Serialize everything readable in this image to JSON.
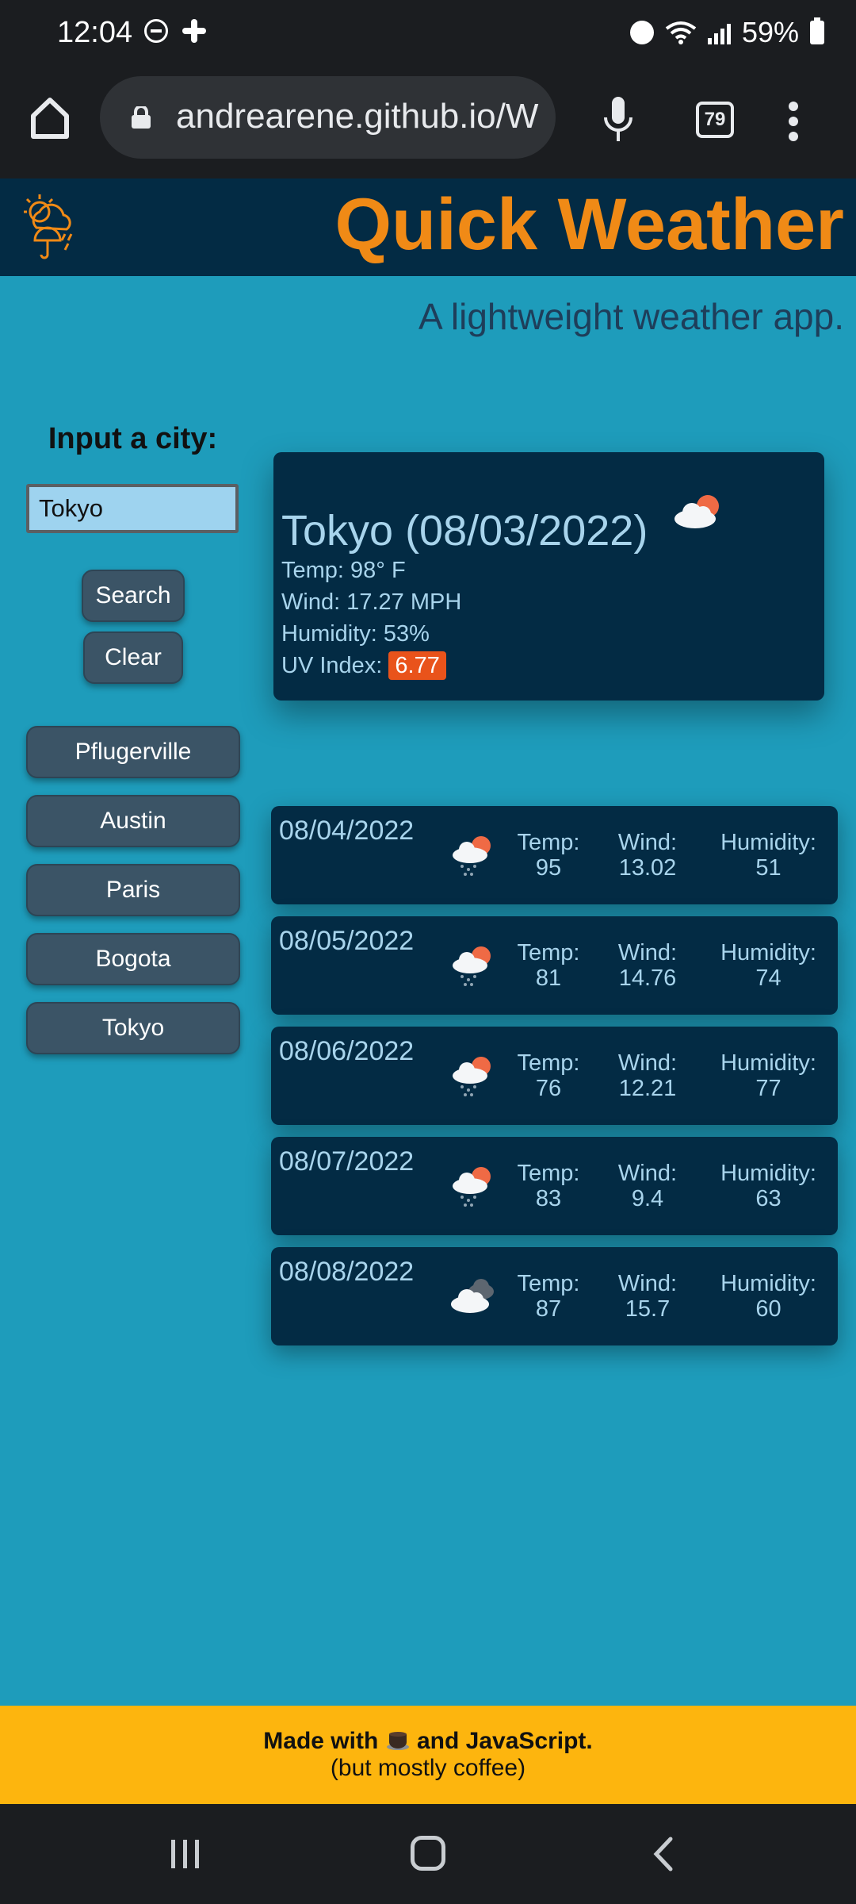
{
  "status_bar": {
    "time": "12:04",
    "battery": "59%"
  },
  "browser": {
    "url": "andrearene.github.io/W",
    "tab_count": "79"
  },
  "app": {
    "title": "Quick Weather",
    "tagline": "A lightweight weather app.",
    "accent_color": "#f08a16",
    "header_bg": "#032b44",
    "page_bg": "#1e9cbb"
  },
  "search": {
    "label": "Input a city:",
    "value": "Tokyo",
    "search_label": "Search",
    "clear_label": "Clear"
  },
  "history": [
    "Pflugerville",
    "Austin",
    "Paris",
    "Bogota",
    "Tokyo"
  ],
  "current": {
    "title": "Tokyo (08/03/2022)",
    "icon": "partly-cloudy-icon",
    "temp": "Temp: 98° F",
    "wind": "Wind: 17.27 MPH",
    "humidity": "Humidity: 53%",
    "uv_label": "UV Index:",
    "uv_value": "6.77",
    "uv_color": "#e9531b"
  },
  "forecast_labels": {
    "temp": "Temp:",
    "wind": "Wind:",
    "humidity": "Humidity:"
  },
  "forecast": [
    {
      "date": "08/04/2022",
      "icon": "rain-sun-icon",
      "temp": "95",
      "wind": "13.02",
      "humidity": "51"
    },
    {
      "date": "08/05/2022",
      "icon": "rain-sun-icon",
      "temp": "81",
      "wind": "14.76",
      "humidity": "74"
    },
    {
      "date": "08/06/2022",
      "icon": "rain-sun-icon",
      "temp": "76",
      "wind": "12.21",
      "humidity": "77"
    },
    {
      "date": "08/07/2022",
      "icon": "rain-sun-icon",
      "temp": "83",
      "wind": "9.4",
      "humidity": "63"
    },
    {
      "date": "08/08/2022",
      "icon": "cloudy-icon",
      "temp": "87",
      "wind": "15.7",
      "humidity": "60"
    }
  ],
  "footer": {
    "line1_before": "Made with",
    "line1_after": "and JavaScript.",
    "line2": "(but mostly coffee)",
    "bg": "#fdb50e"
  }
}
